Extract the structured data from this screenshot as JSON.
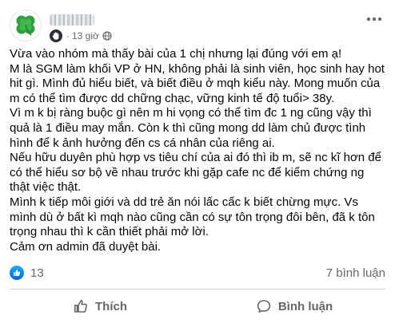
{
  "post": {
    "time": "13 giờ",
    "separator": "·",
    "icons": {
      "avatar": "four-leaf-clover-icon",
      "badge": "waving-hand-icon",
      "privacy": "globe-icon",
      "more": "more-horizontal-icon"
    },
    "body_lines": [
      "Vừa vào nhóm mà thấy bài của 1 chị nhưng lại đúng với em ạ!",
      "M là SGM làm khối VP ở HN, không phải là sinh viên, học sinh hay hot",
      "hit gì. Mình đủ hiểu biết, và biết điều ở mqh kiểu này. Mong muốn của",
      "m có thể tìm được dd chững chạc, vững kinh tế độ tuổi> 38y.",
      "Vì m k bị ràng buộc gì nên m hi vọng có thể tìm đc 1 ng cũng vậy thì",
      "quả là 1 điều may mắn. Còn k thì cũng mong dd làm chủ được tình",
      "hình để k ảnh hưởng đến cs cá nhân của riêng ai.",
      "Nếu hữu duyên phù hợp vs tiêu chí của ai đó thì ib m, sẽ nc kĩ hơn để",
      "có thể hiểu sơ bộ về nhau trước khi gặp cafe nc để kiểm chứng ng",
      "thật việc thật.",
      "Mình k tiếp môi giới và dd trẻ ăn nói lấc cấc k biết chừng mực. Vs",
      "mình dù ở bất kì mqh nào cũng cần có sự tôn trọng đôi bên, đã k tôn",
      "trọng nhau thì k cần thiết phải mở lời.",
      "Cảm ơn admin đã duyệt bài."
    ]
  },
  "stats": {
    "like_count": "13",
    "comment_count": "7 bình luận",
    "like_icon": "like-thumb-icon"
  },
  "actions": {
    "like_label": "Thích",
    "comment_label": "Bình luận"
  },
  "colors": {
    "text": "#050505",
    "secondary": "#65676b",
    "like_blue": "#0866ff",
    "clover_green": "#2e9e3e",
    "divider": "#ced0d4"
  }
}
